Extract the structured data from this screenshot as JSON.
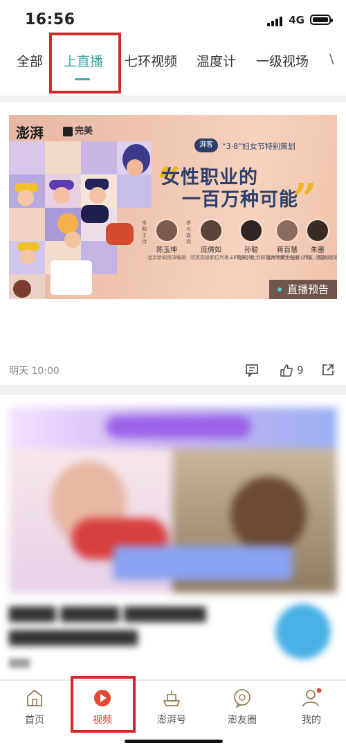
{
  "status_bar": {
    "time": "16:56",
    "network": "4G"
  },
  "tabs": [
    {
      "label": "全部",
      "active": false
    },
    {
      "label": "上直播",
      "active": true
    },
    {
      "label": "七环视频",
      "active": false
    },
    {
      "label": "温度计",
      "active": false
    },
    {
      "label": "一级视场",
      "active": false
    }
  ],
  "card1": {
    "banner": {
      "logo_left": "澎湃",
      "logo_right": "完美",
      "badge": "湃客",
      "campaign": "“3·8”妇女节特别策划",
      "headline_line1": "女性职业的",
      "headline_line2": "一百万种可能",
      "host_label": "本期主持",
      "guest_label": "参与嘉宾",
      "speakers": [
        {
          "name": "陈玉坤",
          "desc": "北京新闻资深编辑"
        },
        {
          "name": "庞倩如",
          "desc": "领英高级职位列表，产品经理"
        },
        {
          "name": "孙聪",
          "desc": "EF英孚，北京职场大学博士在读"
        },
        {
          "name": "蒋百慧",
          "desc": "国际化职业培训公司，全国巡回职场导师"
        },
        {
          "name": "朱墨",
          "desc": "作家、制片人"
        }
      ],
      "live_tag": "直播预告"
    },
    "time": "明天 10:00",
    "likes": "9"
  },
  "bottom_nav": [
    {
      "label": "首页",
      "icon": "home-icon",
      "active": false
    },
    {
      "label": "视频",
      "icon": "video-play-icon",
      "active": true
    },
    {
      "label": "澎湃号",
      "icon": "ship-icon",
      "active": false
    },
    {
      "label": "澎友圈",
      "icon": "chat-circle-icon",
      "active": false
    },
    {
      "label": "我的",
      "icon": "profile-icon",
      "active": false
    }
  ],
  "colors": {
    "accent": "#3aa5a2",
    "highlight_box": "#d02a2a",
    "nav_active": "#d3392b"
  }
}
